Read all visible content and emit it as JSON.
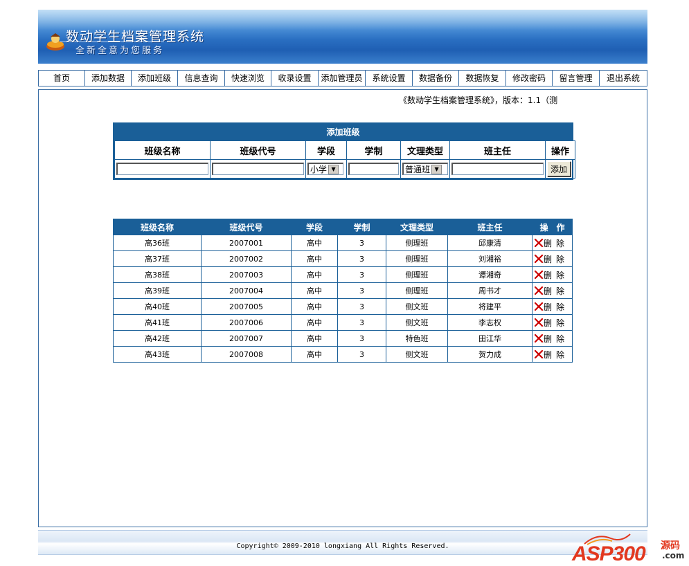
{
  "header": {
    "title": "数动学生档案管理系统",
    "slogan": "全新全意为您服务"
  },
  "nav": {
    "items": [
      "首页",
      "添加数据",
      "添加班级",
      "信息查询",
      "快速浏览",
      "收录设置",
      "添加管理员",
      "系统设置",
      "数据备份",
      "数据恢复",
      "修改密码",
      "留言管理",
      "退出系统"
    ]
  },
  "version_text": "《数动学生档案管理系统》，版本：1.1（测",
  "add_form": {
    "title": "添加班级",
    "headers": [
      "班级名称",
      "班级代号",
      "学段",
      "学制",
      "文理类型",
      "班主任",
      "操作"
    ],
    "stage_select": "小学",
    "type_select": "普通班",
    "add_button": "添加"
  },
  "class_list": {
    "headers": [
      "班级名称",
      "班级代号",
      "学段",
      "学制",
      "文理类型",
      "班主任",
      "操　作"
    ],
    "rows": [
      [
        "高36班",
        "2007001",
        "高中",
        "3",
        "侧理班",
        "邱康清"
      ],
      [
        "高37班",
        "2007002",
        "高中",
        "3",
        "侧理班",
        "刘湘裕"
      ],
      [
        "高38班",
        "2007003",
        "高中",
        "3",
        "侧理班",
        "谭湘奇"
      ],
      [
        "高39班",
        "2007004",
        "高中",
        "3",
        "侧理班",
        "周书才"
      ],
      [
        "高40班",
        "2007005",
        "高中",
        "3",
        "侧文班",
        "将建平"
      ],
      [
        "高41班",
        "2007006",
        "高中",
        "3",
        "侧文班",
        "李志权"
      ],
      [
        "高42班",
        "2007007",
        "高中",
        "3",
        "特色班",
        "田江华"
      ],
      [
        "高43班",
        "2007008",
        "高中",
        "3",
        "侧文班",
        "贺力成"
      ]
    ],
    "delete_label": "删除"
  },
  "footer": {
    "copyright": "Copyright© 2009-2010 longxiang All Rights Reserved."
  },
  "watermark": {
    "brand": "ASP300",
    "side": "源码",
    "domain": ".com"
  },
  "colors": {
    "accent": "#1a5f98",
    "delete_icon": "#cc0000",
    "watermark": "#e2381f"
  }
}
